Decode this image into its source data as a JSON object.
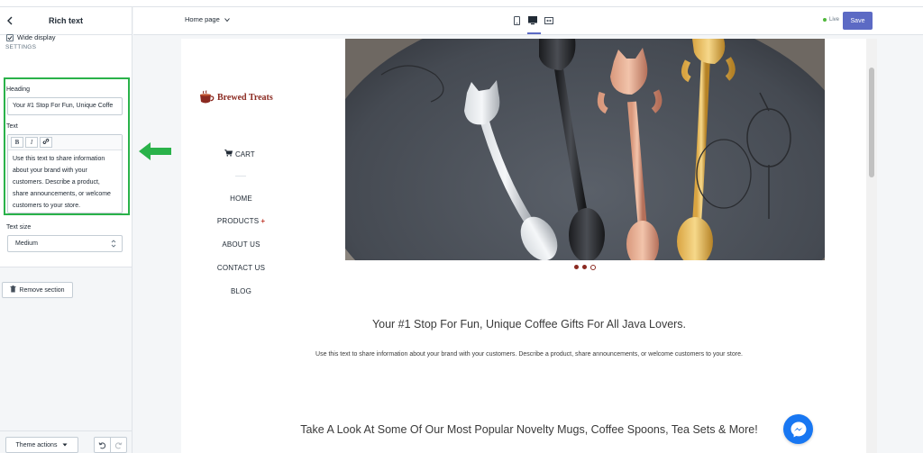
{
  "sidebar": {
    "title": "Rich text",
    "section_label": "SETTINGS",
    "wide_display": {
      "label": "Wide display",
      "checked": true
    },
    "heading": {
      "label": "Heading",
      "value": "Your #1 Stop For Fun, Unique Coffe"
    },
    "text": {
      "label": "Text",
      "toolbar": {
        "bold": "B",
        "italic": "I"
      },
      "content": "Use this text to share information about your brand with your customers. Describe a product, share announcements, or welcome customers to your store."
    },
    "text_size": {
      "label": "Text size",
      "value": "Medium"
    },
    "remove_label": "Remove section",
    "theme_actions_label": "Theme actions"
  },
  "topbar": {
    "page_select": "Home page",
    "live_label": "Live",
    "save_label": "Save"
  },
  "preview": {
    "logo_text": "Brewed Treats",
    "cart_label": "CART",
    "nav": [
      "HOME",
      "PRODUCTS",
      "ABOUT US",
      "CONTACT US",
      "BLOG"
    ],
    "products_plus": "+",
    "heading": "Your #1 Stop For Fun, Unique Coffee Gifts For All Java Lovers.",
    "body": "Use this text to share information about your brand with your customers. Describe a product, share announcements, or welcome customers to your store.",
    "heading2": "Take A Look At Some Of Our Most Popular Novelty Mugs, Coffee Spoons, Tea Sets & More!"
  },
  "colors": {
    "accent": "#5c6ac4",
    "highlight_green": "#2ab24a",
    "brand": "#8b2a21",
    "messenger": "#1877f2"
  }
}
